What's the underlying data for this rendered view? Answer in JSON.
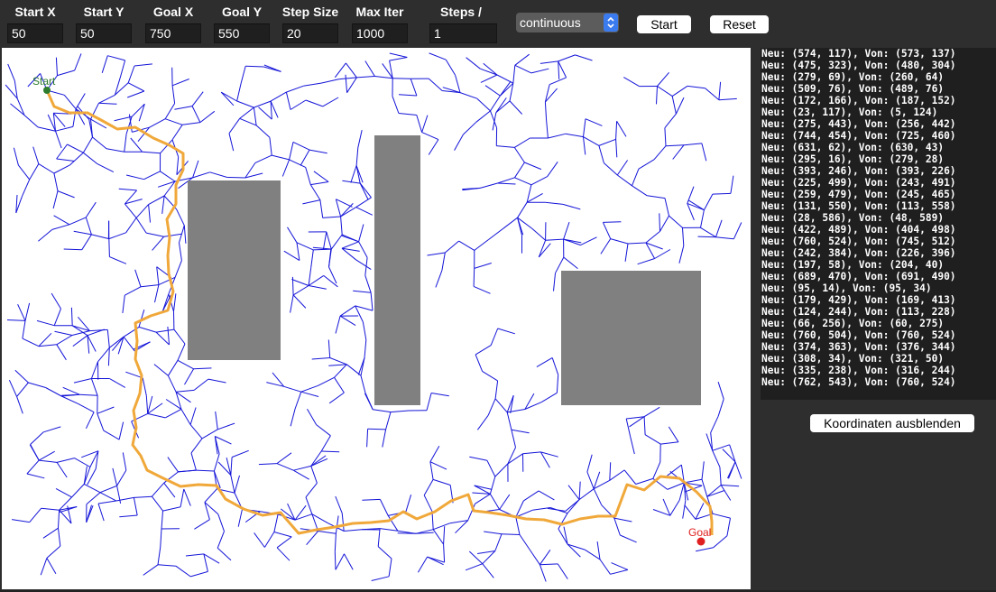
{
  "toolbar": {
    "fields": [
      {
        "label": "Start X",
        "value": "50"
      },
      {
        "label": "Start Y",
        "value": "50"
      },
      {
        "label": "Goal X",
        "value": "750"
      },
      {
        "label": "Goal Y",
        "value": "550"
      },
      {
        "label": "Step Size",
        "value": "20"
      },
      {
        "label": "Max Iter",
        "value": "1000"
      },
      {
        "label": "Steps / Frame",
        "value": "1"
      }
    ],
    "mode_select": "continuous",
    "start_label": "Start",
    "reset_label": "Reset"
  },
  "canvas": {
    "start_label": "Start",
    "goal_label": "Goal",
    "colors": {
      "tree": "#1414d8",
      "path": "#f0a83a",
      "obstacle": "#808080",
      "start": "#2e7d2e",
      "goal": "#e02020"
    }
  },
  "log": {
    "lines": [
      "Neu: (574, 117), Von: (573, 137)",
      "Neu: (475, 323), Von: (480, 304)",
      "Neu: (279, 69), Von: (260, 64)",
      "Neu: (509, 76), Von: (489, 76)",
      "Neu: (172, 166), Von: (187, 152)",
      "Neu: (23, 117), Von: (5, 124)",
      "Neu: (275, 443), Von: (256, 442)",
      "Neu: (744, 454), Von: (725, 460)",
      "Neu: (631, 62), Von: (630, 43)",
      "Neu: (295, 16), Von: (279, 28)",
      "Neu: (393, 246), Von: (393, 226)",
      "Neu: (225, 499), Von: (243, 491)",
      "Neu: (259, 479), Von: (245, 465)",
      "Neu: (131, 550), Von: (113, 558)",
      "Neu: (28, 586), Von: (48, 589)",
      "Neu: (422, 489), Von: (404, 498)",
      "Neu: (760, 524), Von: (745, 512)",
      "Neu: (242, 384), Von: (226, 396)",
      "Neu: (197, 58), Von: (204, 40)",
      "Neu: (689, 470), Von: (691, 490)",
      "Neu: (95, 14), Von: (95, 34)",
      "Neu: (179, 429), Von: (169, 413)",
      "Neu: (124, 244), Von: (113, 228)",
      "Neu: (66, 256), Von: (60, 275)",
      "Neu: (760, 504), Von: (760, 524)",
      "Neu: (374, 363), Von: (376, 344)",
      "Neu: (308, 34), Von: (321, 50)",
      "Neu: (335, 238), Von: (316, 244)",
      "Neu: (762, 543), Von: (760, 524)"
    ],
    "toggle_label": "Koordinaten ausblenden"
  }
}
